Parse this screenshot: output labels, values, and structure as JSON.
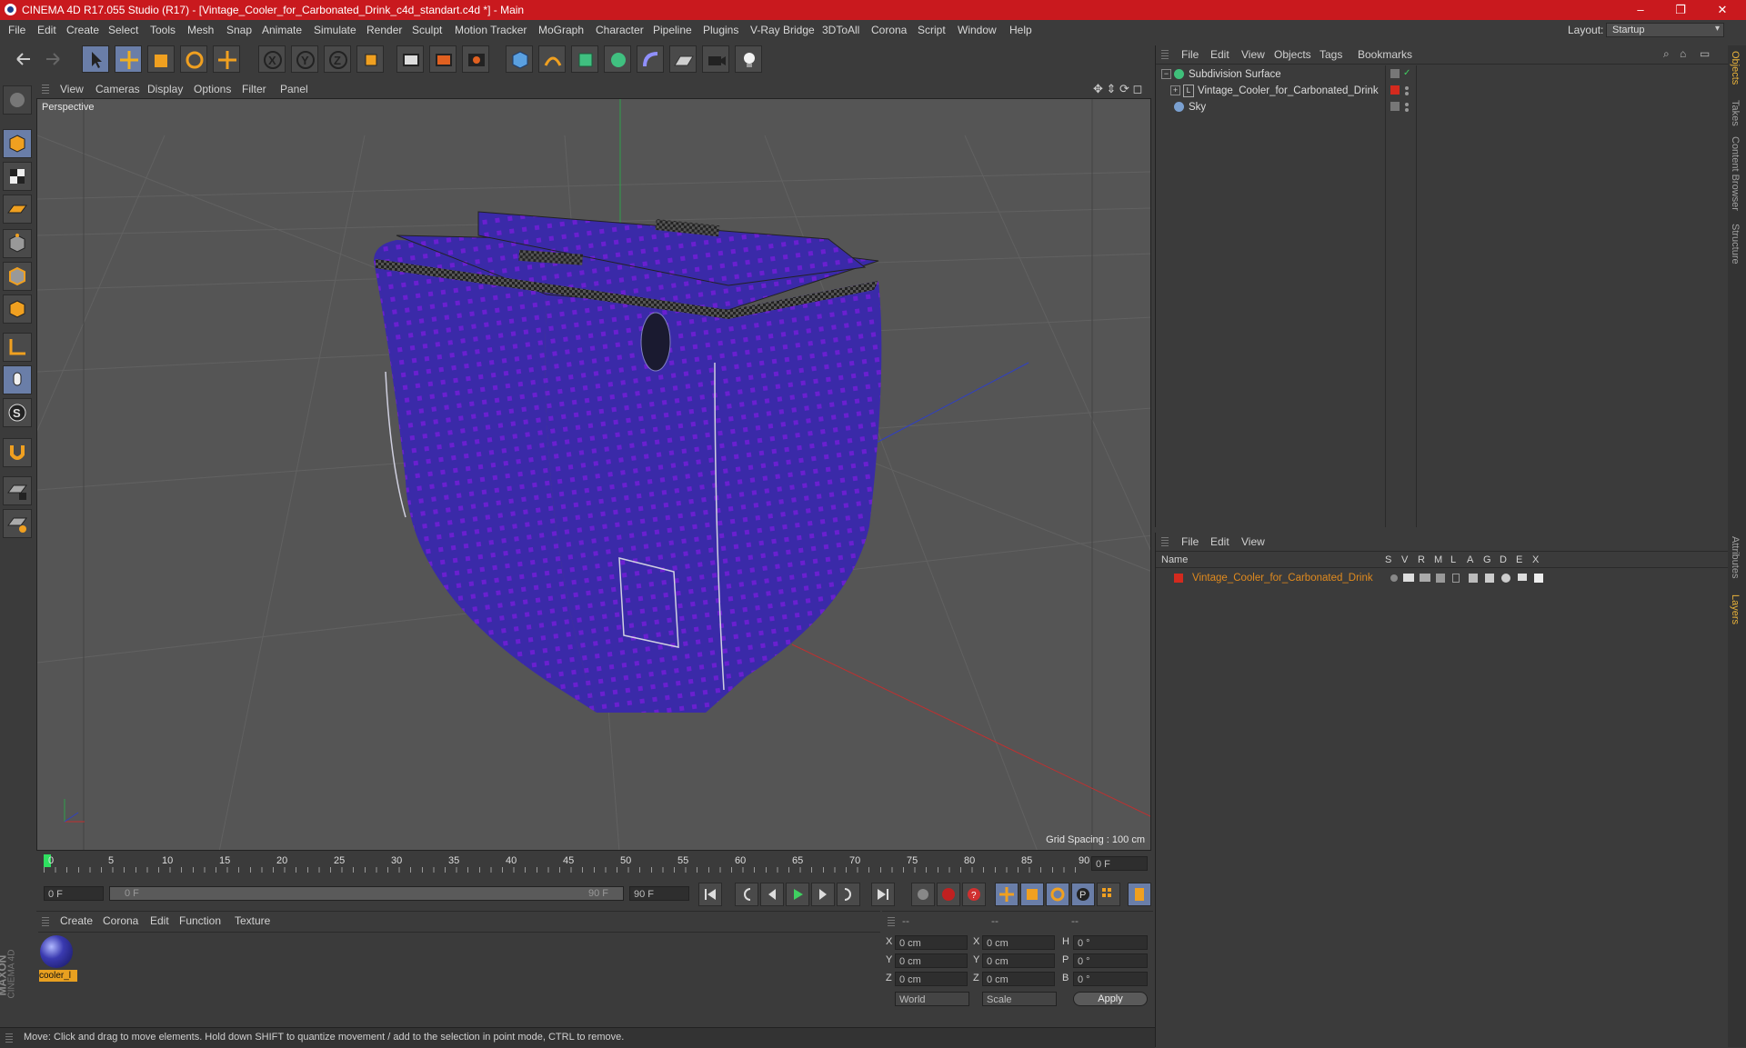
{
  "window": {
    "title": "CINEMA 4D R17.055 Studio (R17) - [Vintage_Cooler_for_Carbonated_Drink_c4d_standart.c4d *] - Main",
    "controls": [
      "–",
      "❐",
      "✕"
    ]
  },
  "menubar": {
    "items": [
      "File",
      "Edit",
      "Create",
      "Select",
      "Tools",
      "Mesh",
      "Snap",
      "Animate",
      "Simulate",
      "Render",
      "Sculpt",
      "Motion Tracker",
      "MoGraph",
      "Character",
      "Pipeline",
      "Plugins",
      "V-Ray Bridge",
      "3DToAll",
      "Corona",
      "Script",
      "Window",
      "Help"
    ],
    "layout_label": "Layout:",
    "layout_value": "Startup"
  },
  "toolbar": {
    "icons": [
      "undo-icon",
      "redo-icon",
      "live-selection-icon",
      "move-icon",
      "scale-icon",
      "rotate-icon",
      "last-tool-icon",
      "x-axis-icon",
      "y-axis-icon",
      "z-axis-icon",
      "coordinate-system-icon",
      "render-view-icon",
      "render-picture-viewer-icon",
      "render-settings-icon",
      "cube-icon",
      "pen-spline-icon",
      "subdivision-icon",
      "array-icon",
      "deformer-icon",
      "floor-icon",
      "camera-icon",
      "light-icon"
    ]
  },
  "viewport": {
    "menu": [
      "View",
      "Cameras",
      "Display",
      "Options",
      "Filter",
      "Panel"
    ],
    "label": "Perspective",
    "grid_spacing": "Grid Spacing : 100 cm",
    "object_color": "#3a2aa8",
    "dot_color": "#6a1fd0"
  },
  "timeline": {
    "ticks": [
      "0",
      "5",
      "10",
      "15",
      "20",
      "25",
      "30",
      "35",
      "40",
      "45",
      "50",
      "55",
      "60",
      "65",
      "70",
      "75",
      "80",
      "85",
      "90"
    ],
    "current_frame": "0 F"
  },
  "transport": {
    "start_field": "0 F",
    "range_start": "0 F",
    "range_end": "90 F",
    "end_field": "90 F"
  },
  "material_manager": {
    "menu": [
      "Create",
      "Corona",
      "Edit",
      "Function",
      "Texture"
    ],
    "materials": [
      {
        "name": "cooler_l"
      }
    ]
  },
  "coordinates": {
    "header": [
      "--",
      "--",
      "--"
    ],
    "rows": [
      {
        "a": "X",
        "av": "0 cm",
        "b": "X",
        "bv": "0 cm",
        "c": "H",
        "cv": "0 °"
      },
      {
        "a": "Y",
        "av": "0 cm",
        "b": "Y",
        "bv": "0 cm",
        "c": "P",
        "cv": "0 °"
      },
      {
        "a": "Z",
        "av": "0 cm",
        "b": "Z",
        "bv": "0 cm",
        "c": "B",
        "cv": "0 °"
      }
    ],
    "space": "World",
    "mode": "Scale",
    "apply": "Apply"
  },
  "object_manager": {
    "menu": [
      "File",
      "Edit",
      "View",
      "Objects",
      "Tags",
      "Bookmarks"
    ],
    "objects": [
      {
        "name": "Subdivision Surface",
        "indent": 0
      },
      {
        "name": "Vintage_Cooler_for_Carbonated_Drink",
        "indent": 1
      },
      {
        "name": "Sky",
        "indent": 0
      }
    ]
  },
  "layer_manager": {
    "menu": [
      "File",
      "Edit",
      "View"
    ],
    "columns": [
      "Name",
      "S",
      "V",
      "R",
      "M",
      "L",
      "A",
      "G",
      "D",
      "E",
      "X"
    ],
    "layers": [
      {
        "name": "Vintage_Cooler_for_Carbonated_Drink",
        "color": "#e08a1e"
      }
    ]
  },
  "side_tabs": [
    "Objects",
    "Takes",
    "Content Browser",
    "Structure",
    "Attributes",
    "Layers"
  ],
  "statusbar": {
    "text": "Move: Click and drag to move elements. Hold down SHIFT to quantize movement / add to the selection in point mode, CTRL to remove."
  },
  "brand": {
    "maxon": "MAXON",
    "product": "CINEMA 4D"
  }
}
